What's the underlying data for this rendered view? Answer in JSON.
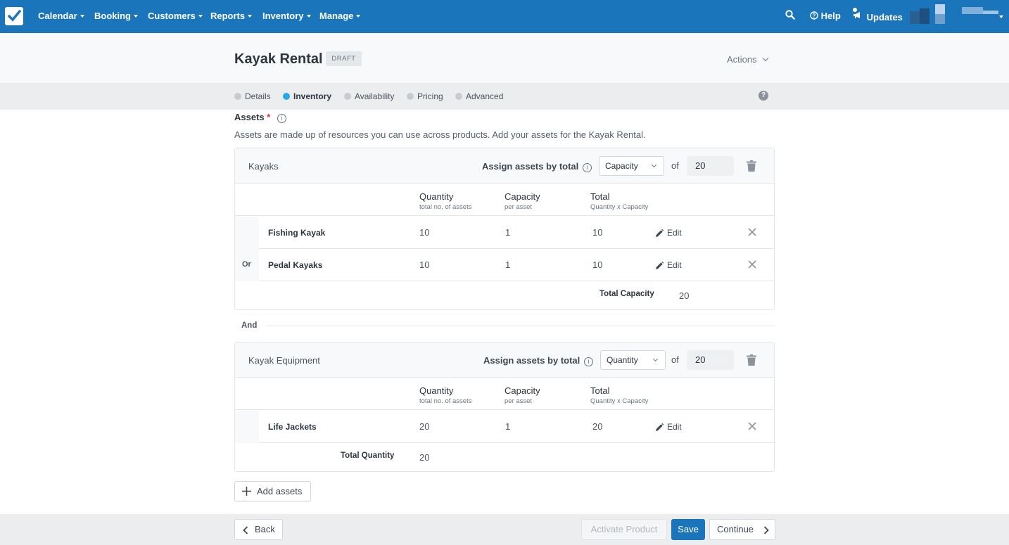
{
  "nav": {
    "items": [
      "Calendar",
      "Booking",
      "Customers",
      "Reports",
      "Inventory",
      "Manage"
    ],
    "help": "Help",
    "updates": "Updates"
  },
  "header": {
    "title": "Kayak Rental",
    "badge": "DRAFT",
    "actions": "Actions"
  },
  "steps": [
    {
      "label": "Details",
      "active": false
    },
    {
      "label": "Inventory",
      "active": true
    },
    {
      "label": "Availability",
      "active": false
    },
    {
      "label": "Pricing",
      "active": false
    },
    {
      "label": "Advanced",
      "active": false
    }
  ],
  "assets": {
    "label": "Assets",
    "required_mark": "*",
    "description": "Assets are made up of resources you can use across products. Add your assets for the Kayak Rental."
  },
  "columns": {
    "quantity": "Quantity",
    "quantity_sub": "total no. of assets",
    "capacity": "Capacity",
    "capacity_sub": "per asset",
    "total": "Total",
    "total_sub": "Quantity x Capacity"
  },
  "group1": {
    "name": "Kayaks",
    "assign_label": "Assign assets by total",
    "select_value": "Capacity",
    "of_label": "of",
    "of_value": "20",
    "rows": [
      {
        "prefix": "",
        "name": "Fishing Kayak",
        "quantity": "10",
        "capacity": "1",
        "total": "10",
        "edit": "Edit"
      },
      {
        "prefix": "Or",
        "name": "Pedal Kayaks",
        "quantity": "10",
        "capacity": "1",
        "total": "10",
        "edit": "Edit"
      }
    ],
    "total_label": "Total Capacity",
    "total_value": "20"
  },
  "and_label": "And",
  "group2": {
    "name": "Kayak Equipment",
    "assign_label": "Assign assets by total",
    "select_value": "Quantity",
    "of_label": "of",
    "of_value": "20",
    "rows": [
      {
        "prefix": "",
        "name": "Life Jackets",
        "quantity": "20",
        "capacity": "1",
        "total": "20",
        "edit": "Edit"
      }
    ],
    "total_label": "Total Quantity",
    "total_value": "20"
  },
  "add_assets": "Add assets",
  "footer": {
    "back": "Back",
    "activate": "Activate Product",
    "save": "Save",
    "continue": "Continue"
  },
  "colors": {
    "brand": "#1b75bb",
    "active_step": "#29a8e0",
    "required": "#d9323a"
  }
}
